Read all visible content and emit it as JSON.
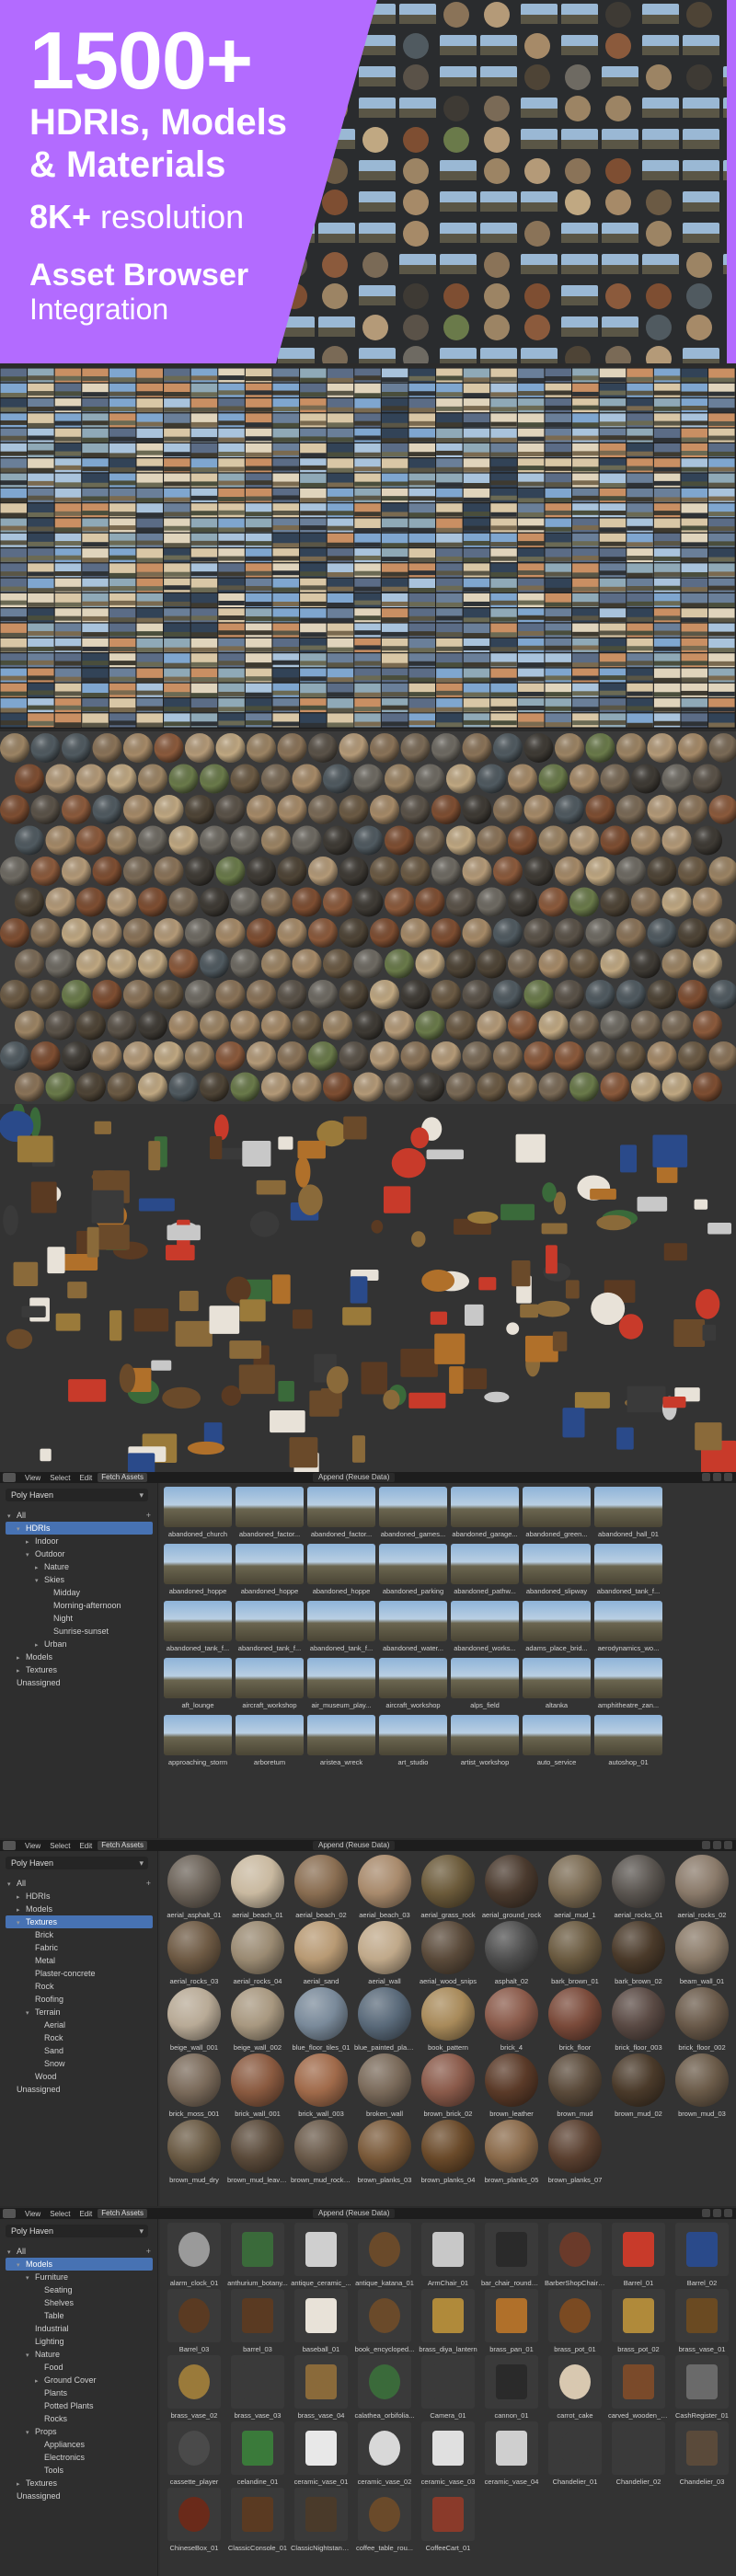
{
  "hero": {
    "big": "1500+",
    "line1": "HDRIs, Models",
    "line2": "& Materials",
    "res_bold": "8K+",
    "res_rest": " resolution",
    "asset_browser": "Asset Browser",
    "integration": "Integration",
    "accent": "#b36bff"
  },
  "toolbar": {
    "view": "View",
    "select": "Select",
    "edit": "Edit",
    "fetch": "Fetch Assets",
    "center": "Append (Reuse Data)"
  },
  "panel1": {
    "library": "Poly Haven",
    "tree": [
      {
        "label": "All",
        "indent": 0,
        "arrow": "▾",
        "sel": false,
        "add": true
      },
      {
        "label": "HDRIs",
        "indent": 1,
        "arrow": "▾",
        "sel": true
      },
      {
        "label": "Indoor",
        "indent": 2,
        "arrow": "▸",
        "sel": false
      },
      {
        "label": "Outdoor",
        "indent": 2,
        "arrow": "▾",
        "sel": false
      },
      {
        "label": "Nature",
        "indent": 3,
        "arrow": "▸",
        "sel": false
      },
      {
        "label": "Skies",
        "indent": 3,
        "arrow": "▾",
        "sel": false
      },
      {
        "label": "Midday",
        "indent": 4,
        "arrow": "",
        "sel": false
      },
      {
        "label": "Morning-afternoon",
        "indent": 4,
        "arrow": "",
        "sel": false
      },
      {
        "label": "Night",
        "indent": 4,
        "arrow": "",
        "sel": false
      },
      {
        "label": "Sunrise-sunset",
        "indent": 4,
        "arrow": "",
        "sel": false
      },
      {
        "label": "Urban",
        "indent": 3,
        "arrow": "▸",
        "sel": false
      },
      {
        "label": "Models",
        "indent": 1,
        "arrow": "▸",
        "sel": false
      },
      {
        "label": "Textures",
        "indent": 1,
        "arrow": "▸",
        "sel": false
      },
      {
        "label": "Unassigned",
        "indent": 0,
        "arrow": "",
        "sel": false
      }
    ],
    "tiles": [
      "abandoned_church",
      "abandoned_factor...",
      "abandoned_factor...",
      "abandoned_games...",
      "abandoned_garage...",
      "abandoned_green...",
      "abandoned_hall_01",
      "abandoned_hoppe",
      "abandoned_hoppe",
      "abandoned_hoppe",
      "abandoned_parking",
      "abandoned_pathw...",
      "abandoned_slipway",
      "abandoned_tank_f...",
      "abandoned_tank_f...",
      "abandoned_tank_f...",
      "abandoned_tank_f...",
      "abandoned_water...",
      "abandoned_works...",
      "adams_place_brid...",
      "aerodynamics_wo...",
      "aft_lounge",
      "aircraft_workshop",
      "air_museum_play...",
      "aircraft_workshop",
      "alps_field",
      "altanka",
      "amphitheatre_zan...",
      "approaching_storm",
      "arboretum",
      "aristea_wreck",
      "art_studio",
      "artist_workshop",
      "auto_service",
      "autoshop_01"
    ]
  },
  "panel2": {
    "library": "Poly Haven",
    "tree": [
      {
        "label": "All",
        "indent": 0,
        "arrow": "▾",
        "sel": false,
        "add": true
      },
      {
        "label": "HDRIs",
        "indent": 1,
        "arrow": "▸",
        "sel": false
      },
      {
        "label": "Models",
        "indent": 1,
        "arrow": "▸",
        "sel": false
      },
      {
        "label": "Textures",
        "indent": 1,
        "arrow": "▾",
        "sel": true
      },
      {
        "label": "Brick",
        "indent": 2,
        "arrow": "",
        "sel": false
      },
      {
        "label": "Fabric",
        "indent": 2,
        "arrow": "",
        "sel": false
      },
      {
        "label": "Metal",
        "indent": 2,
        "arrow": "",
        "sel": false
      },
      {
        "label": "Plaster-concrete",
        "indent": 2,
        "arrow": "",
        "sel": false
      },
      {
        "label": "Rock",
        "indent": 2,
        "arrow": "",
        "sel": false
      },
      {
        "label": "Roofing",
        "indent": 2,
        "arrow": "",
        "sel": false
      },
      {
        "label": "Terrain",
        "indent": 2,
        "arrow": "▾",
        "sel": false
      },
      {
        "label": "Aerial",
        "indent": 3,
        "arrow": "",
        "sel": false
      },
      {
        "label": "Rock",
        "indent": 3,
        "arrow": "",
        "sel": false
      },
      {
        "label": "Sand",
        "indent": 3,
        "arrow": "",
        "sel": false
      },
      {
        "label": "Snow",
        "indent": 3,
        "arrow": "",
        "sel": false
      },
      {
        "label": "Wood",
        "indent": 2,
        "arrow": "",
        "sel": false
      },
      {
        "label": "Unassigned",
        "indent": 0,
        "arrow": "",
        "sel": false
      }
    ],
    "tiles": [
      "aerial_asphalt_01",
      "aerial_beach_01",
      "aerial_beach_02",
      "aerial_beach_03",
      "aerial_grass_rock",
      "aerial_ground_rock",
      "aerial_mud_1",
      "aerial_rocks_01",
      "aerial_rocks_02",
      "aerial_rocks_03",
      "aerial_rocks_04",
      "aerial_sand",
      "aerial_wall",
      "aerial_wood_snips",
      "asphalt_02",
      "bark_brown_01",
      "bark_brown_02",
      "beam_wall_01",
      "beige_wall_001",
      "beige_wall_002",
      "blue_floor_tiles_01",
      "blue_painted_plan...",
      "book_pattern",
      "brick_4",
      "brick_floor",
      "brick_floor_003",
      "brick_floor_002",
      "brick_moss_001",
      "brick_wall_001",
      "brick_wall_003",
      "broken_wall",
      "brown_brick_02",
      "brown_leather",
      "brown_mud",
      "brown_mud_02",
      "brown_mud_03",
      "brown_mud_dry",
      "brown_mud_leave...",
      "brown_mud_rocks...",
      "brown_planks_03",
      "brown_planks_04",
      "brown_planks_05",
      "brown_planks_07"
    ],
    "colors": [
      "#6b6258",
      "#c9b9a0",
      "#8a6e52",
      "#a88a6c",
      "#6b5a3a",
      "#4a3a2e",
      "#7a6a52",
      "#5a5550",
      "#8a7a6a",
      "#6e5a44",
      "#9a8a72",
      "#b89a74",
      "#c0a98a",
      "#5a4a3a",
      "#4e4e4e",
      "#6a5a40",
      "#4a3a2a",
      "#8a7a68",
      "#b8aa96",
      "#a89880",
      "#7a8a9a",
      "#5a6a7a",
      "#a88a5a",
      "#8a5a4a",
      "#7a4a3a",
      "#5a4a44",
      "#6a5a4a",
      "#7a6a5a",
      "#8a5a40",
      "#a06a4a",
      "#7a6a5a",
      "#8a5a4a",
      "#5a3a28",
      "#5a4a3a",
      "#4a3a2a",
      "#6a5a48",
      "#6a5a44",
      "#5a4a3a",
      "#6a5a4a",
      "#7a5a3a",
      "#6a4a2a",
      "#8a6a4a",
      "#5a4030"
    ]
  },
  "panel3": {
    "library": "Poly Haven",
    "tree": [
      {
        "label": "All",
        "indent": 0,
        "arrow": "▾",
        "sel": false,
        "add": true
      },
      {
        "label": "Models",
        "indent": 1,
        "arrow": "▾",
        "sel": true
      },
      {
        "label": "Furniture",
        "indent": 2,
        "arrow": "▾",
        "sel": false
      },
      {
        "label": "Seating",
        "indent": 3,
        "arrow": "",
        "sel": false
      },
      {
        "label": "Shelves",
        "indent": 3,
        "arrow": "",
        "sel": false
      },
      {
        "label": "Table",
        "indent": 3,
        "arrow": "",
        "sel": false
      },
      {
        "label": "Industrial",
        "indent": 2,
        "arrow": "",
        "sel": false
      },
      {
        "label": "Lighting",
        "indent": 2,
        "arrow": "",
        "sel": false
      },
      {
        "label": "Nature",
        "indent": 2,
        "arrow": "▾",
        "sel": false
      },
      {
        "label": "Food",
        "indent": 3,
        "arrow": "",
        "sel": false
      },
      {
        "label": "Ground Cover",
        "indent": 3,
        "arrow": "▸",
        "sel": false
      },
      {
        "label": "Plants",
        "indent": 3,
        "arrow": "",
        "sel": false
      },
      {
        "label": "Potted Plants",
        "indent": 3,
        "arrow": "",
        "sel": false
      },
      {
        "label": "Rocks",
        "indent": 3,
        "arrow": "",
        "sel": false
      },
      {
        "label": "Props",
        "indent": 2,
        "arrow": "▾",
        "sel": false
      },
      {
        "label": "Appliances",
        "indent": 3,
        "arrow": "",
        "sel": false
      },
      {
        "label": "Electronics",
        "indent": 3,
        "arrow": "",
        "sel": false
      },
      {
        "label": "Tools",
        "indent": 3,
        "arrow": "",
        "sel": false
      },
      {
        "label": "Textures",
        "indent": 1,
        "arrow": "▸",
        "sel": false
      },
      {
        "label": "Unassigned",
        "indent": 0,
        "arrow": "",
        "sel": false
      }
    ],
    "tiles": [
      "alarm_clock_01",
      "anthurium_botany...",
      "antique_ceramic_...",
      "antique_katana_01",
      "ArmChair_01",
      "bar_chair_round_01",
      "BarberShopChair_...",
      "Barrel_01",
      "Barrel_02",
      "Barrel_03",
      "barrel_03",
      "baseball_01",
      "book_encycloped...",
      "brass_diya_lantern",
      "brass_pan_01",
      "brass_pot_01",
      "brass_pot_02",
      "brass_vase_01",
      "brass_vase_02",
      "brass_vase_03",
      "brass_vase_04",
      "calathea_orbifolia...",
      "Camera_01",
      "cannon_01",
      "carrot_cake",
      "carved_wooden_el...",
      "CashRegister_01",
      "cassette_player",
      "celandine_01",
      "ceramic_vase_01",
      "ceramic_vase_02",
      "ceramic_vase_03",
      "ceramic_vase_04",
      "Chandelier_01",
      "Chandelier_02",
      "Chandelier_03",
      "ChineseBox_01",
      "ClassicConsole_01",
      "ClassicNightstand...",
      "coffee_table_rou...",
      "CoffeeCart_01"
    ],
    "colors": [
      "#9a9a9a",
      "#3a6a3a",
      "#cfcfcf",
      "#6a4a2a",
      "#c8c8c8",
      "#2a2a2a",
      "#6a3a2a",
      "#c83a2a",
      "#2a4a8a",
      "#5a3a22",
      "#5a3a22",
      "#e8e2d8",
      "#6a4a2a",
      "#b08a3a",
      "#b0702a",
      "#7a4a22",
      "#b08a3a",
      "#6a4a22",
      "#9a7a3a",
      "#3a3a3a",
      "#8a6a3a",
      "#3a6a3a",
      "#3a3a3a",
      "#2a2a2a",
      "#d8c8b0",
      "#7a4a2a",
      "#6a6a6a",
      "#4a4a4a",
      "#3a7a3a",
      "#e8e8e8",
      "#d8d8d8",
      "#e0e0e0",
      "#cfcfcf",
      "#3a3a3a",
      "#3a3a3a",
      "#5a4a3a",
      "#6a2a1a",
      "#5a3a22",
      "#4a3a2a",
      "#6a4a2a",
      "#8a3a2a"
    ]
  }
}
